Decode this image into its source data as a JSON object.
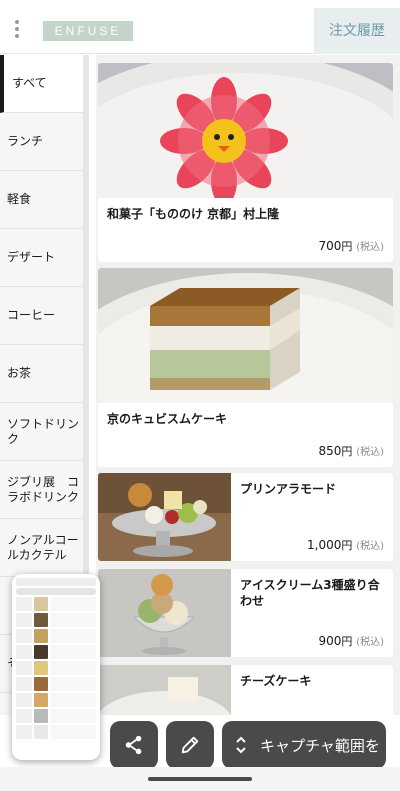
{
  "header": {
    "logo_text": "ENFUSE",
    "order_history_label": "注文履歴"
  },
  "sidebar": {
    "categories": [
      {
        "label": "すべて",
        "active": true
      },
      {
        "label": "ランチ"
      },
      {
        "label": "軽食"
      },
      {
        "label": "デザート"
      },
      {
        "label": "コーヒー"
      },
      {
        "label": "お茶"
      },
      {
        "label": "ソフトドリンク"
      },
      {
        "label": "ジブリ展　コラボドリンク"
      },
      {
        "label": "ノンアルコールカクテル"
      },
      {
        "label": "ア"
      },
      {
        "label": "そ"
      }
    ]
  },
  "menu_items": [
    {
      "name": "和菓子「もののけ 京都」村上隆",
      "price": "700",
      "currency": "円",
      "tax_note": "(税込)"
    },
    {
      "name": "京のキュビスムケーキ",
      "price": "850",
      "currency": "円",
      "tax_note": "(税込)"
    },
    {
      "name": "プリンアラモード",
      "price": "1,000",
      "currency": "円",
      "tax_note": "(税込)"
    },
    {
      "name": "アイスクリーム3種盛り合わせ",
      "price": "900",
      "currency": "円",
      "tax_note": "(税込)"
    },
    {
      "name": "チーズケーキ",
      "price": "",
      "currency": "",
      "tax_note": ""
    }
  ],
  "toolbar": {
    "share_icon": "share-icon",
    "edit_icon": "pencil-icon",
    "capture_range_label": "キャプチャ範囲を"
  },
  "colors": {
    "logo_bg": "#c3d4c9",
    "order_history_bg": "#e8eef0",
    "order_history_text": "#6a9aa8",
    "toolbar_button": "#4a4a4a"
  }
}
